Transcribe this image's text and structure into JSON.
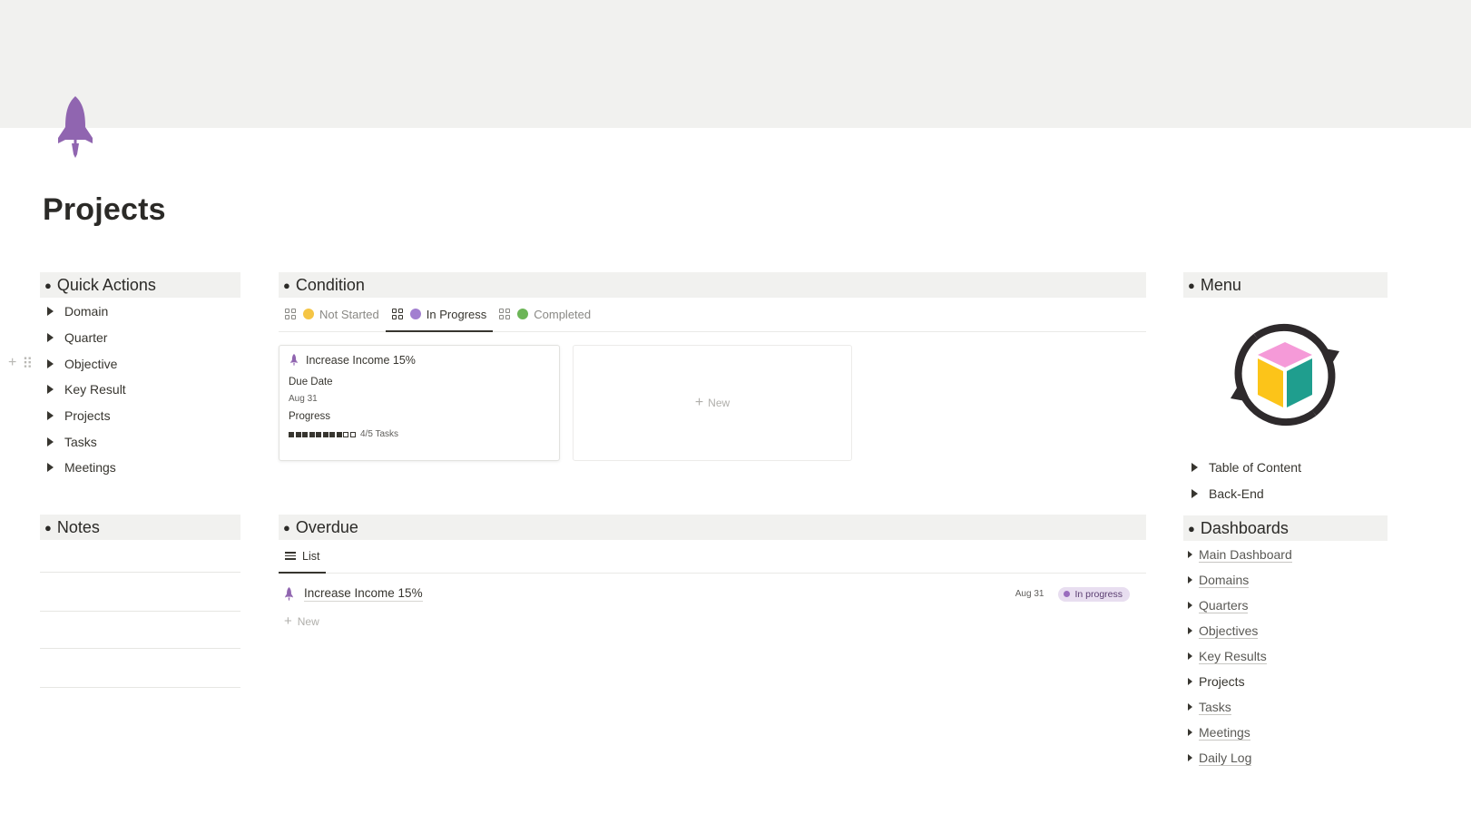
{
  "page": {
    "title": "Projects",
    "icon": "rocket-icon",
    "accent": "#9065b0"
  },
  "quick_actions": {
    "title": "Quick Actions",
    "items": [
      "Domain",
      "Quarter",
      "Objective",
      "Key Result",
      "Projects",
      "Tasks",
      "Meetings"
    ]
  },
  "notes": {
    "title": "Notes"
  },
  "condition": {
    "title": "Condition",
    "tabs": [
      {
        "label": "Not Started",
        "color": "#f5c545",
        "active": false
      },
      {
        "label": "In Progress",
        "color": "#a27fd0",
        "active": true
      },
      {
        "label": "Completed",
        "color": "#6cb557",
        "active": false
      }
    ],
    "card": {
      "title": "Increase Income 15%",
      "due_label": "Due Date",
      "due_value": "Aug 31",
      "progress_label": "Progress",
      "progress_filled": 8,
      "progress_total": 10,
      "progress_text": "4/5 Tasks"
    },
    "new_label": "New"
  },
  "overdue": {
    "title": "Overdue",
    "view_label": "List",
    "rows": [
      {
        "title": "Increase Income 15%",
        "date": "Aug 31",
        "status": "In progress"
      }
    ],
    "new_label": "New"
  },
  "menu": {
    "title": "Menu",
    "logo": "refresh-cube-logo",
    "items": [
      "Table of Content",
      "Back-End"
    ]
  },
  "dashboards": {
    "title": "Dashboards",
    "items": [
      {
        "label": "Main Dashboard",
        "link": true
      },
      {
        "label": "Domains",
        "link": true
      },
      {
        "label": "Quarters",
        "link": true
      },
      {
        "label": "Objectives",
        "link": true
      },
      {
        "label": "Key Results",
        "link": true
      },
      {
        "label": "Projects",
        "link": false
      },
      {
        "label": "Tasks",
        "link": true
      },
      {
        "label": "Meetings",
        "link": true
      },
      {
        "label": "Daily Log",
        "link": true
      }
    ]
  }
}
